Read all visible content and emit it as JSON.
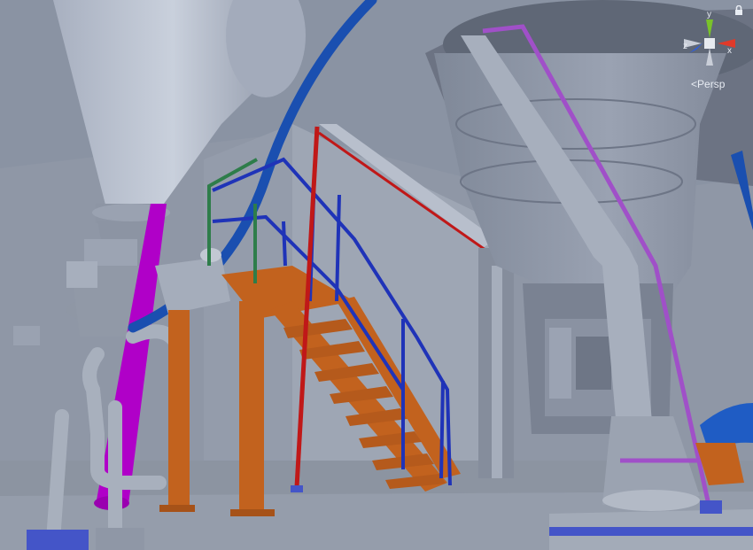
{
  "viewport": {
    "projection_label": "Persp",
    "projection_arrow": "<"
  },
  "gizmo": {
    "axis_y": "y",
    "axis_x": "x",
    "axis_z": "z"
  },
  "icons": {
    "lock": "lock-icon",
    "orientation_gizmo": "axis-gizmo-icon"
  },
  "colors": {
    "background": "#8f97a6",
    "stairs": "#c2621e",
    "handrail_blue": "#1f33b8",
    "handrail_green": "#2e7d4a",
    "pipe_magenta": "#b000c8",
    "pipe_violet": "#a050c8",
    "hose_blue": "#1a4fb0",
    "pipe_red": "#c01818",
    "gizmo_x": "#e03a2a",
    "gizmo_y": "#7ac32a",
    "gizmo_z": "#2a5ee8"
  }
}
